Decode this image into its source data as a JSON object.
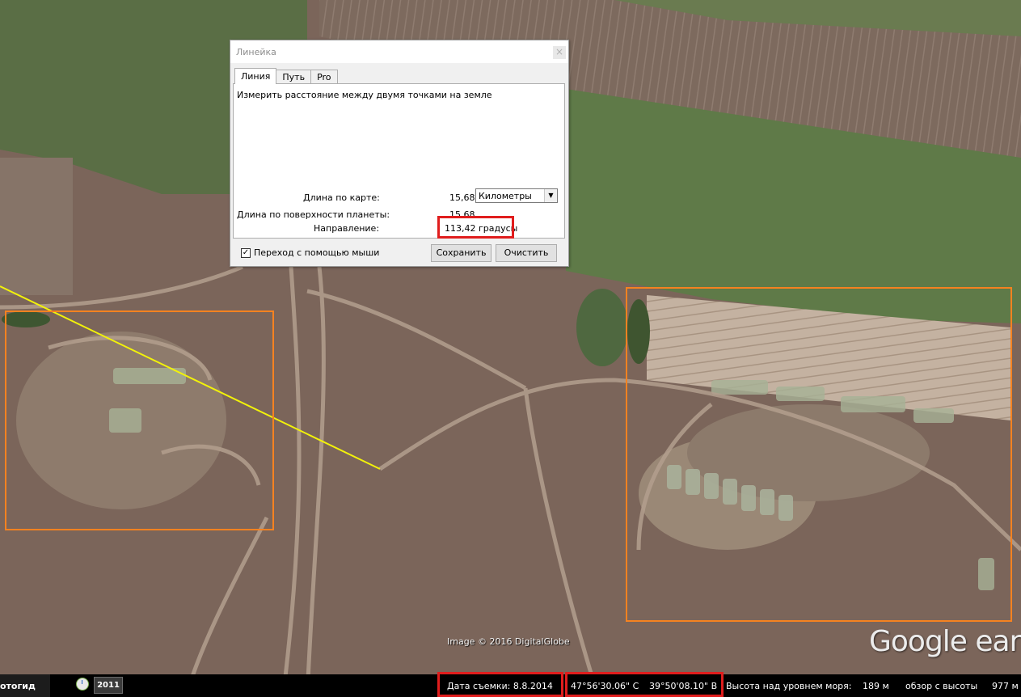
{
  "dialog": {
    "title": "Линейка",
    "close_glyph": "×",
    "tabs": [
      "Линия",
      "Путь",
      "Pro"
    ],
    "description": "Измерить расстояние между двумя точками на земле",
    "map_length_label": "Длина по карте:",
    "map_length_value": "15,68",
    "unit_selected": "Километры",
    "surface_length_label": "Длина по поверхности планеты:",
    "surface_length_value": "15,68",
    "heading_label": "Направление:",
    "heading_value": "113,42 градусы",
    "mouse_nav_label": "Переход с помощью мыши",
    "mouse_nav_checked": true,
    "save_label": "Сохранить",
    "clear_label": "Очистить"
  },
  "map": {
    "imagery_credit": "Image © 2016 DigitalGlobe",
    "logo_text": "Google earth"
  },
  "statusbar": {
    "left_label": "отогид",
    "year": "2011",
    "imagery_date": "Дата съемки: 8.8.2014",
    "latitude": "47°56'30.06\" С",
    "longitude": "39°50'08.10\" В",
    "elevation_label": "Высота над уровнем моря:",
    "elevation_value": "189 м",
    "eye_alt_label": "обзор с высоты",
    "eye_alt_value": "977 м"
  },
  "colors": {
    "annotation_orange": "#f58220",
    "highlight_red": "#e01d1d",
    "ruler_line": "#f2f20a"
  },
  "icons": {
    "clock": "clock-icon",
    "dropdown": "chevron-down-icon",
    "checkbox": "checkmark-icon"
  }
}
